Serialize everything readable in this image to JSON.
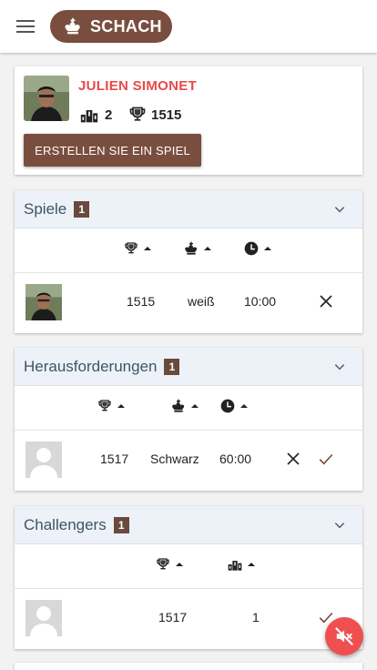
{
  "app": {
    "brand": "SCHACH"
  },
  "profile": {
    "name": "JULIEN SIMONET",
    "rank": "2",
    "rating": "1515",
    "create_button": "ERSTELLEN SIE EIN SPIEL"
  },
  "games": {
    "title": "Spiele",
    "count": "1",
    "rows": [
      {
        "rating": "1515",
        "color": "weiß",
        "time": "10:00"
      }
    ]
  },
  "challenges": {
    "title": "Herausforderungen",
    "count": "1",
    "rows": [
      {
        "rating": "1517",
        "color": "Schwarz",
        "time": "60:00"
      }
    ]
  },
  "challengers": {
    "title": "Challengers",
    "count": "1",
    "rows": [
      {
        "rating": "1517",
        "rank": "1"
      }
    ]
  },
  "icons": {
    "menu": "hamburger-icon",
    "brand": "crown-icon",
    "rank": "podium-icon",
    "rating": "trophy-icon",
    "color": "king-icon",
    "time": "clock-icon",
    "expand": "chevron-down-icon",
    "decline": "close-icon",
    "accept": "check-icon",
    "sound": "sound-off-icon"
  },
  "colors": {
    "brand": "#7a4e3e",
    "accent_red": "#e84a4a",
    "header_bg": "#ecf2f7",
    "fab": "#ef4f4f"
  }
}
